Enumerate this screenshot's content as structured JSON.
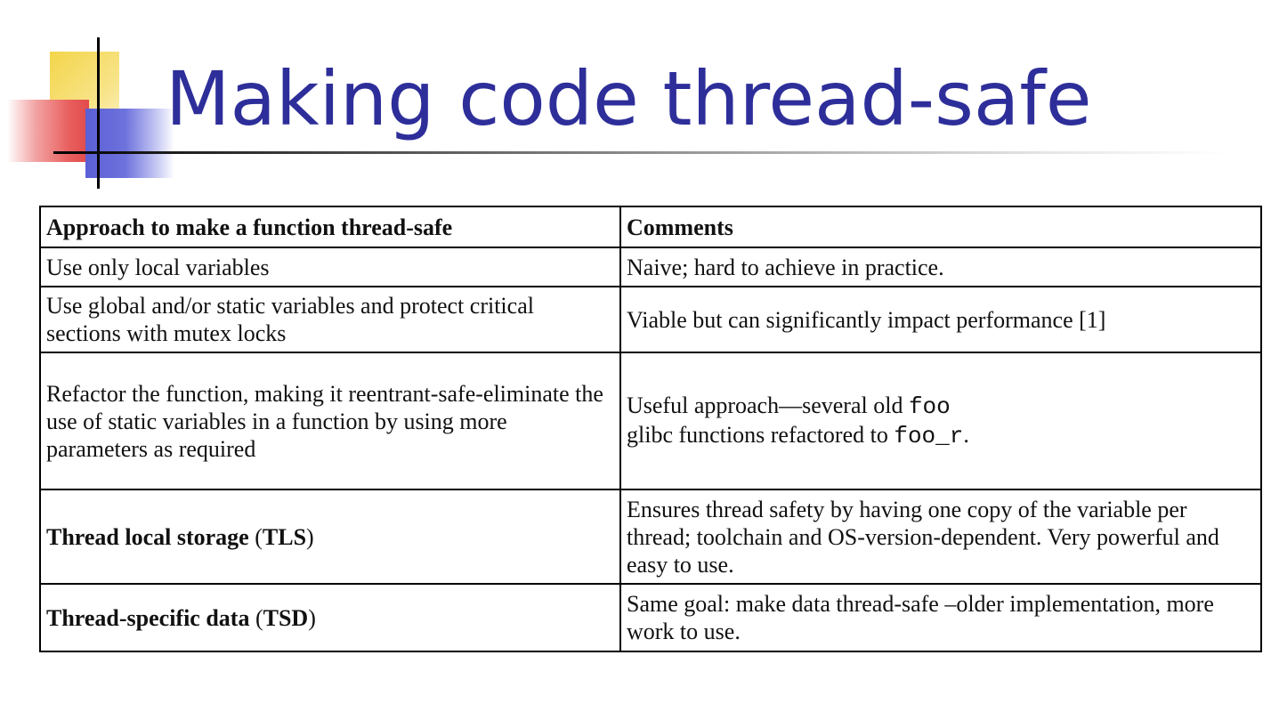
{
  "slide": {
    "title": "Making code thread-safe"
  },
  "table": {
    "headers": {
      "approach": "Approach to make a function thread-safe",
      "comments": "Comments"
    },
    "rows": [
      {
        "approach": "Use only local variables",
        "comment": "Naive; hard to achieve in practice."
      },
      {
        "approach": "Use global and/or static variables and protect critical sections with mutex locks",
        "comment": "Viable but can significantly impact performance [1]"
      },
      {
        "approach": "Refactor the function, making it reentrant-safe-eliminate the use of static variables in a function by using more parameters as required",
        "comment_parts": {
          "text1": "Useful approach—several old ",
          "code1": "foo",
          "text2": "glibc functions refactored to ",
          "code2": "foo_r",
          "text3": "."
        }
      },
      {
        "approach_main": "Thread local storage",
        "approach_paren_open": " (",
        "approach_abbr": "TLS",
        "approach_paren_close": ")",
        "comment": "Ensures thread safety by having one copy of the variable per thread; toolchain and OS-version-dependent. Very powerful and easy to use."
      },
      {
        "approach_main": "Thread-specific data",
        "approach_paren_open": " (",
        "approach_abbr": "TSD",
        "approach_paren_close": ")",
        "comment": "Same goal: make data thread-safe –older implementation, more work to use."
      }
    ]
  },
  "colors": {
    "title": "#2e2e9a",
    "deco_yellow": "#f3d54a",
    "deco_red": "#e24a4a",
    "deco_blue": "#5b5fd6"
  }
}
